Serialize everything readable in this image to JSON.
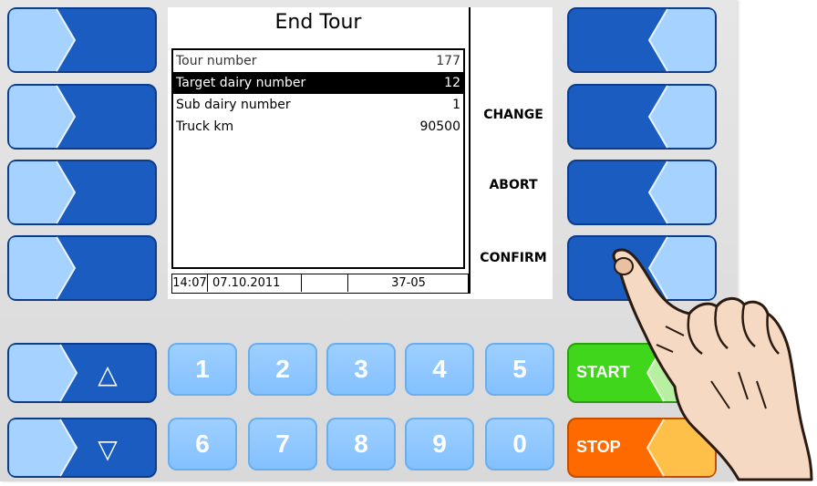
{
  "screen": {
    "title": "End Tour",
    "rows": [
      {
        "label": "Tour number",
        "value": "177"
      },
      {
        "label": "Target dairy number",
        "value": "12"
      },
      {
        "label": "Sub dairy number",
        "value": "1"
      },
      {
        "label": "Truck km",
        "value": "90500"
      }
    ],
    "selected_index": 1,
    "status": {
      "time": "14:07",
      "date": "07.10.2011",
      "code": "37-05"
    },
    "softkey_labels": {
      "change": "CHANGE",
      "abort": "ABORT",
      "confirm": "CONFIRM"
    }
  },
  "numeric_keys": {
    "top": [
      "1",
      "2",
      "3",
      "4",
      "5"
    ],
    "bottom": [
      "6",
      "7",
      "8",
      "9",
      "0"
    ]
  },
  "arrow_keys": {
    "up": "△",
    "down": "▽"
  },
  "start_label": "START",
  "stop_label": "STOP",
  "colors": {
    "key_dark": "#1155b8",
    "key_light": "#a6d2ff",
    "start": "#3fd61c",
    "stop": "#ff6a00"
  }
}
